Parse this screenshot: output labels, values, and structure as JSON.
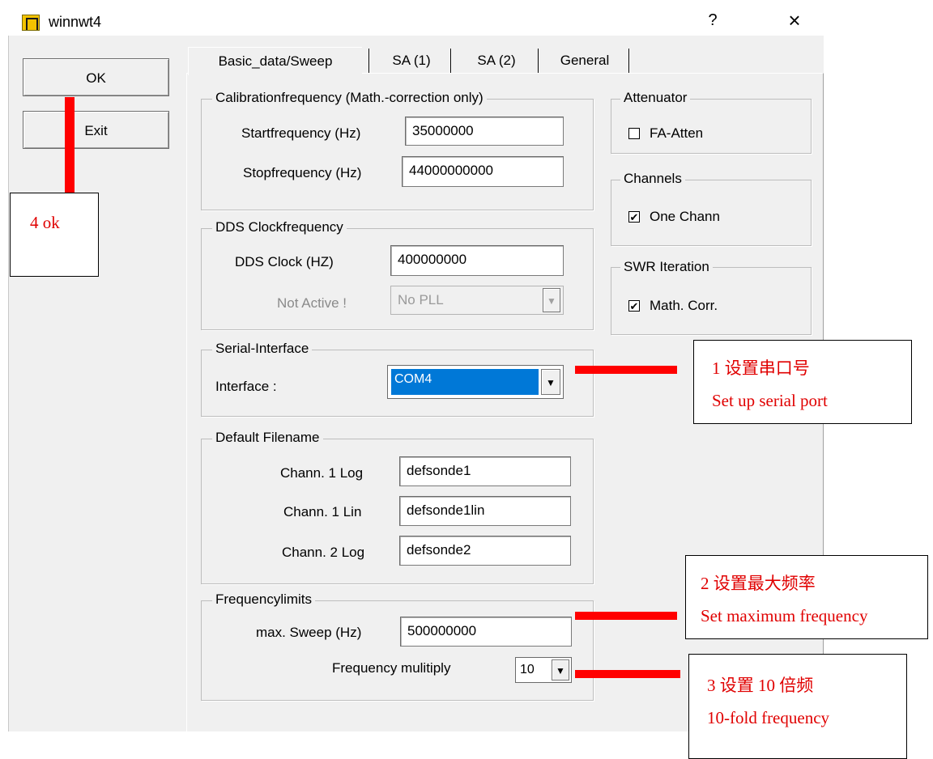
{
  "window": {
    "title": "winnwt4",
    "help_glyph": "?",
    "close_glyph": "×"
  },
  "buttons": {
    "ok": "OK",
    "exit": "Exit"
  },
  "tabs": [
    "Basic_data/Sweep",
    "SA (1)",
    "SA (2)",
    "General"
  ],
  "calibration": {
    "legend": "Calibrationfrequency (Math.-correction only)",
    "start_label": "Startfrequency (Hz)",
    "start_value": "35000000",
    "stop_label": "Stopfrequency (Hz)",
    "stop_value": "44000000000"
  },
  "dds": {
    "legend": "DDS Clockfrequency",
    "clock_label": "DDS Clock (HZ)",
    "clock_value": "400000000",
    "pll_label": "Not Active !",
    "pll_value": "No PLL"
  },
  "serial": {
    "legend": "Serial-Interface",
    "interface_label": "Interface :",
    "interface_value": "COM4"
  },
  "filenames": {
    "legend": "Default Filename",
    "rows": [
      {
        "label": "Chann. 1  Log",
        "value": "defsonde1"
      },
      {
        "label": "Chann. 1  Lin",
        "value": "defsonde1lin"
      },
      {
        "label": "Chann. 2 Log",
        "value": "defsonde2"
      }
    ]
  },
  "limits": {
    "legend": "Frequencylimits",
    "max_label": "max. Sweep (Hz)",
    "max_value": "500000000",
    "multiply_label": "Frequency mulitiply",
    "multiply_value": "10"
  },
  "attenuator": {
    "legend": "Attenuator",
    "label": "FA-Atten",
    "checked": false
  },
  "channels": {
    "legend": "Channels",
    "label": "One Chann",
    "checked": true
  },
  "swr": {
    "legend": "SWR Iteration",
    "label": "Math. Corr.",
    "checked": true
  },
  "annotations": {
    "ok_note": "4 ok",
    "serial_note": [
      "1 设置串口号",
      "Set up serial port"
    ],
    "maxfreq_note": [
      "2 设置最大频率",
      "Set maximum frequency"
    ],
    "multiply_note": [
      "3 设置 10 倍频",
      "10-fold frequency"
    ],
    "color": "#e00000"
  },
  "colors": {
    "dialog_bg": "#f0f0f0",
    "selection": "#0078d7",
    "annotation_line": "#ff0000"
  },
  "icons": {
    "checkbox_check": "✔",
    "dropdown_arrow": "▼"
  }
}
